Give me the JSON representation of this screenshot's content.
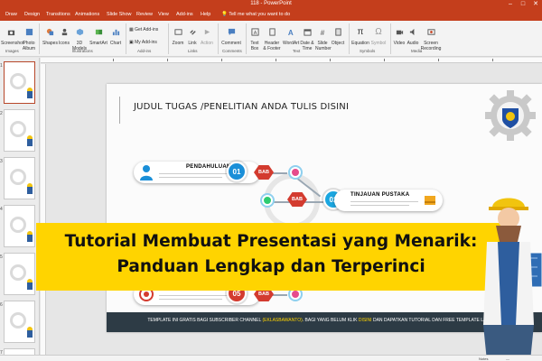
{
  "app": {
    "window_title": "118  -  PowerPoint",
    "accent": "#c43e1c",
    "tell_me": "Tell me what you want to do"
  },
  "tabs": [
    "Draw",
    "Design",
    "Transitions",
    "Animations",
    "Slide Show",
    "Review",
    "View",
    "Add-ins",
    "Help"
  ],
  "ribbon": {
    "buttons": [
      {
        "label": "Screenshot",
        "icon": "camera-icon"
      },
      {
        "label": "Photo\nAlbum",
        "icon": "photo-album-icon"
      },
      {
        "label": "Shapes",
        "icon": "shapes-icon"
      },
      {
        "label": "Icons",
        "icon": "icons-icon"
      },
      {
        "label": "3D\nModels",
        "icon": "cube-icon"
      },
      {
        "label": "SmartArt",
        "icon": "smartart-icon"
      },
      {
        "label": "Chart",
        "icon": "chart-icon"
      },
      {
        "label": "Get Add-ins",
        "icon": "store-icon"
      },
      {
        "label": "My Add-ins",
        "icon": "addins-icon"
      },
      {
        "label": "Zoom",
        "icon": "zoom-icon"
      },
      {
        "label": "Link",
        "icon": "link-icon"
      },
      {
        "label": "Action",
        "icon": "action-icon"
      },
      {
        "label": "Comment",
        "icon": "comment-icon"
      },
      {
        "label": "Text\nBox",
        "icon": "textbox-icon"
      },
      {
        "label": "Header\n& Footer",
        "icon": "header-footer-icon"
      },
      {
        "label": "WordArt",
        "icon": "wordart-icon"
      },
      {
        "label": "Date &\nTime",
        "icon": "calendar-icon"
      },
      {
        "label": "Slide\nNumber",
        "icon": "hash-icon"
      },
      {
        "label": "Object",
        "icon": "object-icon"
      },
      {
        "label": "Equation",
        "icon": "pi-icon"
      },
      {
        "label": "Symbol",
        "icon": "omega-icon"
      },
      {
        "label": "Video",
        "icon": "video-icon"
      },
      {
        "label": "Audio",
        "icon": "audio-icon"
      },
      {
        "label": "Screen\nRecording",
        "icon": "record-icon"
      }
    ],
    "groups": [
      "Images",
      "Illustrations",
      "Add-ins",
      "Links",
      "Comments",
      "Text",
      "Symbols",
      "Media"
    ]
  },
  "thumbnails": [
    "1",
    "2",
    "3",
    "4",
    "5",
    "6",
    "7"
  ],
  "slide": {
    "title": "JUDUL TUGAS /PENELITIAN ANDA TULIS DISINI",
    "items": [
      {
        "label": "PENDAHULUAN",
        "num": "01",
        "tag": "BAB",
        "color": "#1a8fd8"
      },
      {
        "label": "TINJAUAN PUSTAKA",
        "num": "02",
        "tag": "BAB",
        "color": "#1aa6e0"
      },
      {
        "label": "SIMPULAN",
        "num": "05",
        "tag": "BAB",
        "color": "#d33b2f"
      }
    ],
    "footer": {
      "part1": "TEMPLATE INI GRATIS BAGI SUBSCRIBER CHANNEL",
      "link1": "(EKLASBAWANTO)",
      "part2": ". BAGI YANG BELUM KLIK",
      "link2": "DISINI",
      "part3": "DAN DAPATKAN TUTORIAL DAN FREE TEMPLATE LAINNYA."
    }
  },
  "banner": {
    "line1": "Tutorial Membuat Presentasi yang Menarik:",
    "line2": "Panduan Lengkap dan Terperinci",
    "color": "#ffd400"
  },
  "status": {
    "notes": "Notes",
    "zoom": "—"
  }
}
